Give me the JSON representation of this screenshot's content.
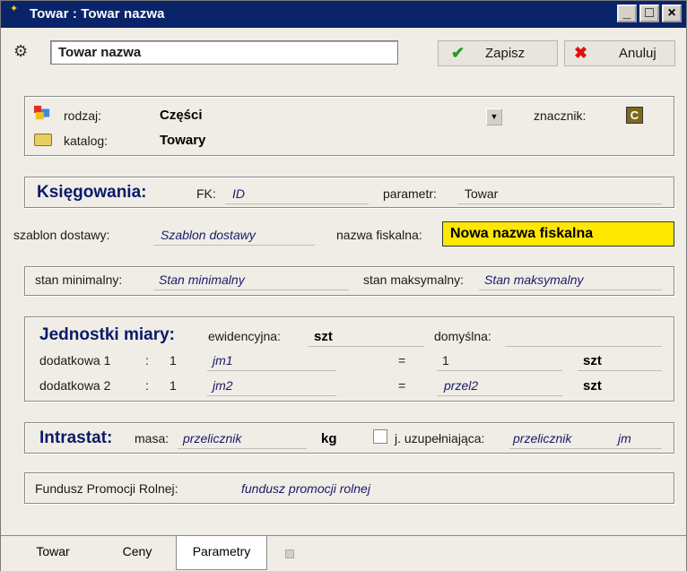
{
  "window": {
    "title": "Towar : Towar nazwa"
  },
  "toolbar": {
    "name_value": "Towar nazwa",
    "save_label": "Zapisz",
    "cancel_label": "Anuluj"
  },
  "type_section": {
    "rodzaj_label": "rodzaj:",
    "rodzaj_value": "Części",
    "znacznik_label": "znacznik:",
    "znacznik_value": "C",
    "katalog_label": "katalog:",
    "katalog_value": "Towary"
  },
  "accounting": {
    "heading": "Księgowania:",
    "fk_label": "FK:",
    "fk_value": "ID",
    "param_label": "parametr:",
    "param_value": "Towar"
  },
  "delivery": {
    "template_label": "szablon dostawy:",
    "template_value": "Szablon dostawy",
    "fiscal_label": "nazwa fiskalna:",
    "fiscal_value": "Nowa nazwa fiskalna"
  },
  "stock": {
    "min_label": "stan minimalny:",
    "min_value": "Stan minimalny",
    "max_label": "stan maksymalny:",
    "max_value": "Stan maksymalny"
  },
  "units": {
    "heading": "Jednostki miary:",
    "evid_label": "ewidencyjna:",
    "evid_value": "szt",
    "default_label": "domyślna:",
    "rows": [
      {
        "label": "dodatkowa 1",
        "colon": ":",
        "qty": "1",
        "unit": "jm1",
        "eq": "=",
        "factor": "1",
        "base": "szt"
      },
      {
        "label": "dodatkowa 2",
        "colon": ":",
        "qty": "1",
        "unit": "jm2",
        "eq": "=",
        "factor": "przel2",
        "base": "szt"
      }
    ]
  },
  "intrastat": {
    "heading": "Intrastat:",
    "mass_label": "masa:",
    "mass_value": "przelicznik",
    "mass_unit": "kg",
    "supp_label": "j. uzupełniająca:",
    "supp_value": "przelicznik",
    "supp_unit": "jm"
  },
  "fund": {
    "label": "Fundusz Promocji Rolnej:",
    "value": "fundusz promocji rolnej"
  },
  "tabs": [
    {
      "label": "Towar",
      "active": false
    },
    {
      "label": "Ceny",
      "active": false
    },
    {
      "label": "Parametry",
      "active": true
    }
  ]
}
